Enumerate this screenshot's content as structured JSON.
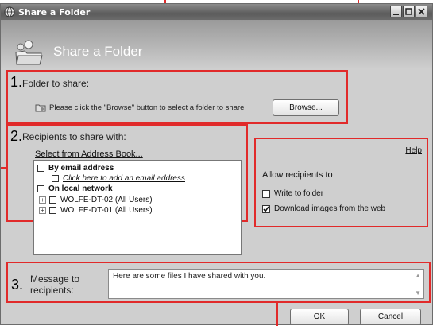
{
  "window": {
    "title": "Share a Folder"
  },
  "header": {
    "title": "Share a Folder"
  },
  "section1": {
    "number": "1.",
    "label": "Folder to share:",
    "hint": "Please click the \"Browse\" button to select a folder to share",
    "browse_label": "Browse..."
  },
  "section2": {
    "number": "2.",
    "label": "Recipients to share with:",
    "address_book_link": "Select from Address Book...",
    "tree": {
      "email_group": "By email address",
      "add_email_link": "Click here to add an email address",
      "local_group": "On local network",
      "computers": [
        "WOLFE-DT-02 (All Users)",
        "WOLFE-DT-01 (All Users)"
      ]
    }
  },
  "options": {
    "help_link": "Help",
    "allow_label": "Allow recipients to",
    "write_label": "Write to folder",
    "write_checked": false,
    "download_label": "Download images from the web",
    "download_checked": true
  },
  "section3": {
    "number": "3.",
    "label_line1": "Message to",
    "label_line2": "recipients:",
    "message_text": "Here are some files I have shared with you."
  },
  "footer": {
    "ok_label": "OK",
    "cancel_label": "Cancel"
  },
  "colors": {
    "highlight_red": "#e12a2a",
    "window_gray": "#cfcfcf"
  }
}
